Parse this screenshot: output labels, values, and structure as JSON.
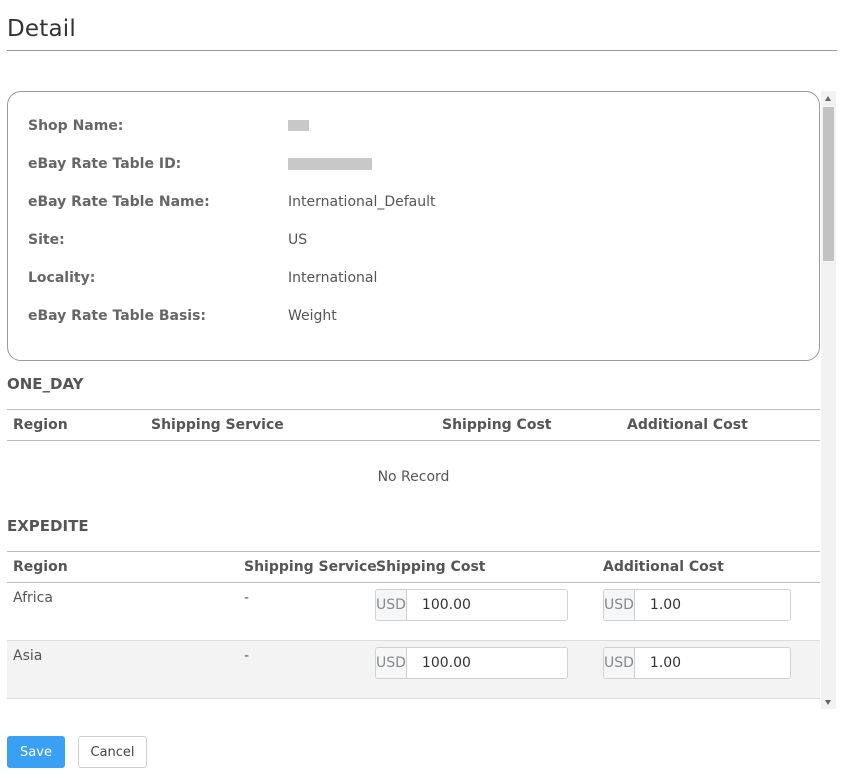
{
  "page": {
    "title": "Detail"
  },
  "info": {
    "rows": [
      {
        "label": "Shop Name:",
        "value": ""
      },
      {
        "label": "eBay Rate Table ID:",
        "value": ""
      },
      {
        "label": "eBay Rate Table Name:",
        "value": "International_Default"
      },
      {
        "label": "Site:",
        "value": "US"
      },
      {
        "label": "Locality:",
        "value": "International"
      },
      {
        "label": "eBay Rate Table Basis:",
        "value": "Weight"
      }
    ]
  },
  "sections": {
    "one_day": {
      "title": "ONE_DAY",
      "headers": [
        "Region",
        "Shipping Service",
        "Shipping Cost",
        "Additional Cost"
      ],
      "empty_text": "No Record"
    },
    "expedite": {
      "title": "EXPEDITE",
      "headers": [
        "Region",
        "Shipping Service",
        "Shipping Cost",
        "Additional Cost"
      ],
      "rows": [
        {
          "region": "Africa",
          "service": "-",
          "currency": "USD",
          "shipping_cost": "100.00",
          "additional_cost": "1.00"
        },
        {
          "region": "Asia",
          "service": "-",
          "currency": "USD",
          "shipping_cost": "100.00",
          "additional_cost": "1.00"
        }
      ]
    }
  },
  "footer": {
    "save_label": "Save",
    "cancel_label": "Cancel"
  },
  "colors": {
    "primary": "#3aa0f3",
    "row_alt": "#f3f3f3"
  }
}
